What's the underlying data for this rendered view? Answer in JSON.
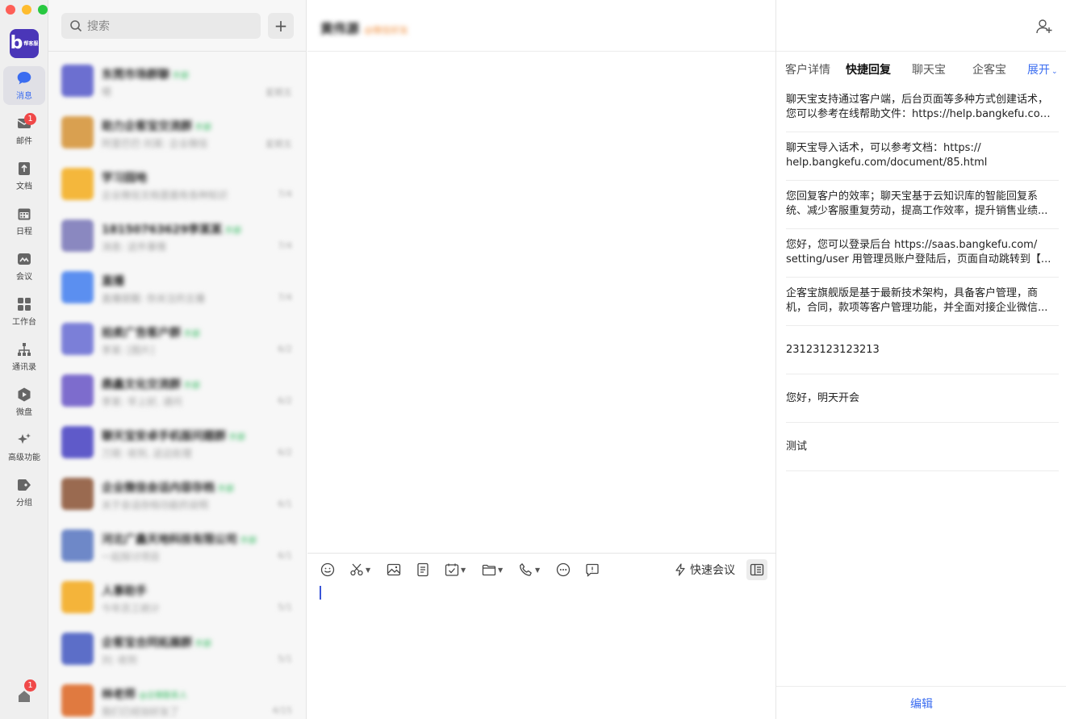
{
  "nav": {
    "items": [
      {
        "label": "消息",
        "badge": ""
      },
      {
        "label": "邮件",
        "badge": "1"
      },
      {
        "label": "文档",
        "badge": ""
      },
      {
        "label": "日程",
        "badge": ""
      },
      {
        "label": "会议",
        "badge": ""
      },
      {
        "label": "工作台",
        "badge": ""
      },
      {
        "label": "通讯录",
        "badge": ""
      },
      {
        "label": "微盘",
        "badge": ""
      },
      {
        "label": "高级功能",
        "badge": ""
      },
      {
        "label": "分组",
        "badge": ""
      }
    ],
    "bottom_badge": "1",
    "logo_text": "b",
    "logo_sub": "帮客服"
  },
  "search": {
    "placeholder": "搜索"
  },
  "conversations": [
    {
      "name": "东莞市场群聊",
      "tag": "外部",
      "snip": "嗯",
      "time": "星期五",
      "color": "#6c6fd0"
    },
    {
      "name": "助力企客宝交流群",
      "tag": "外部",
      "snip": "阿里巴巴·刘某: 企业微信",
      "time": "星期五",
      "color": "#d9a050"
    },
    {
      "name": "学习园地",
      "tag": "",
      "snip": "企业微信文档里面有各种知识",
      "time": "7/4",
      "color": "#f4b73c"
    },
    {
      "name": "18150763629李某某",
      "tag": "外部",
      "snip": "消息: 这件事情",
      "time": "7/4",
      "color": "#8a88c0"
    },
    {
      "name": "直播",
      "tag": "",
      "snip": "直播提醒: 你关注的主播",
      "time": "7/4",
      "color": "#5b8ff0"
    },
    {
      "name": "拍卖广告客户群",
      "tag": "外部",
      "snip": "李某: [图片]",
      "time": "6/2",
      "color": "#7b7fd8"
    },
    {
      "name": "鼎鑫文化交流群",
      "tag": "外部",
      "snip": "李某: 早上好, 请问",
      "time": "6/2",
      "color": "#7d6ccd"
    },
    {
      "name": "聊天宝安卓手机版问题群",
      "tag": "外部",
      "snip": "刀哥: 收到, 这边处理",
      "time": "6/2",
      "color": "#5f5ac9"
    },
    {
      "name": "企业微信会话内容存档",
      "tag": "外部",
      "snip": "关于会话存档功能的说明",
      "time": "6/1",
      "color": "#9a6a50"
    },
    {
      "name": "河北广鑫天地科技有限公司",
      "tag": "外部",
      "snip": "一起探讨项目",
      "time": "6/1",
      "color": "#6e88c8"
    },
    {
      "name": "人事助手",
      "tag": "",
      "snip": "今年员工统计",
      "time": "5/1",
      "color": "#f4b43a"
    },
    {
      "name": "企客宝合同拓展群",
      "tag": "外部",
      "snip": "刘: 收到",
      "time": "5/1",
      "color": "#5c6ec8"
    },
    {
      "name": "林老师",
      "tag": "@企微联系人",
      "snip": "我们已经加好友了",
      "time": "4/15",
      "color": "#e07a40"
    }
  ],
  "chat": {
    "title": "黄伟源",
    "subtitle": "@微信好友",
    "quick_meeting": "快速会议"
  },
  "right_panel": {
    "tabs": [
      "客户详情",
      "快捷回复",
      "聊天宝",
      "企客宝",
      "展开"
    ],
    "active_tab": "快捷回复",
    "quick_replies": [
      {
        "lines": [
          "聊天宝支持通过客户端，后台页面等多种方式创建话术，",
          "您可以参考在线帮助文件：https://help.bangkefu.com/..."
        ]
      },
      {
        "lines": [
          "聊天宝导入话术，可以参考文档：https://",
          "help.bangkefu.com/document/85.html"
        ]
      },
      {
        "lines": [
          "您回复客户的效率；聊天宝基于云知识库的智能回复系",
          "统、减少客服重复劳动，提高工作效率，提升销售业绩..."
        ]
      },
      {
        "lines": [
          "您好，您可以登录后台 https://saas.bangkefu.com/",
          "setting/user 用管理员账户登陆后，页面自动跳转到【..."
        ]
      },
      {
        "lines": [
          "企客宝旗舰版是基于最新技术架构，具备客户管理，商",
          "机，合同，款项等客户管理功能，并全面对接企业微信..."
        ]
      },
      {
        "lines": [
          "23123123123213"
        ]
      },
      {
        "lines": [
          "您好，明天开会"
        ]
      },
      {
        "lines": [
          "测试"
        ]
      }
    ],
    "edit_label": "编辑"
  }
}
